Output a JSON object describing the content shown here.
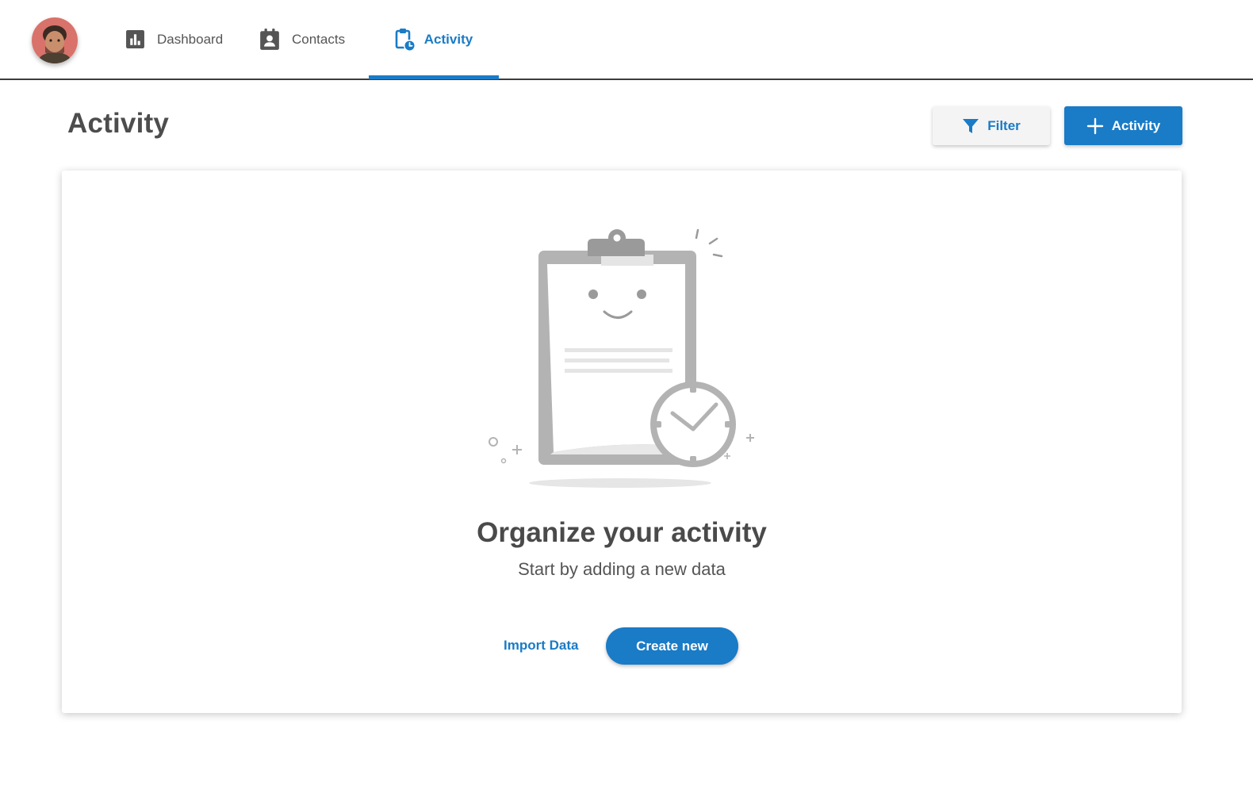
{
  "nav": {
    "items": [
      {
        "label": "Dashboard",
        "icon": "bar-chart-icon",
        "active": false
      },
      {
        "label": "Contacts",
        "icon": "contact-card-icon",
        "active": false
      },
      {
        "label": "Activity",
        "icon": "clipboard-clock-icon",
        "active": true
      }
    ]
  },
  "header": {
    "title": "Activity",
    "filter_label": "Filter",
    "add_label": "Activity"
  },
  "empty_state": {
    "illustration": "clipboard-with-clock",
    "title": "Organize your activity",
    "subtitle": "Start by adding a new data",
    "import_label": "Import Data",
    "create_label": "Create new"
  },
  "colors": {
    "accent": "#1a7bc6",
    "text": "#4a4a4a",
    "illustration_gray": "#b3b3b3"
  }
}
